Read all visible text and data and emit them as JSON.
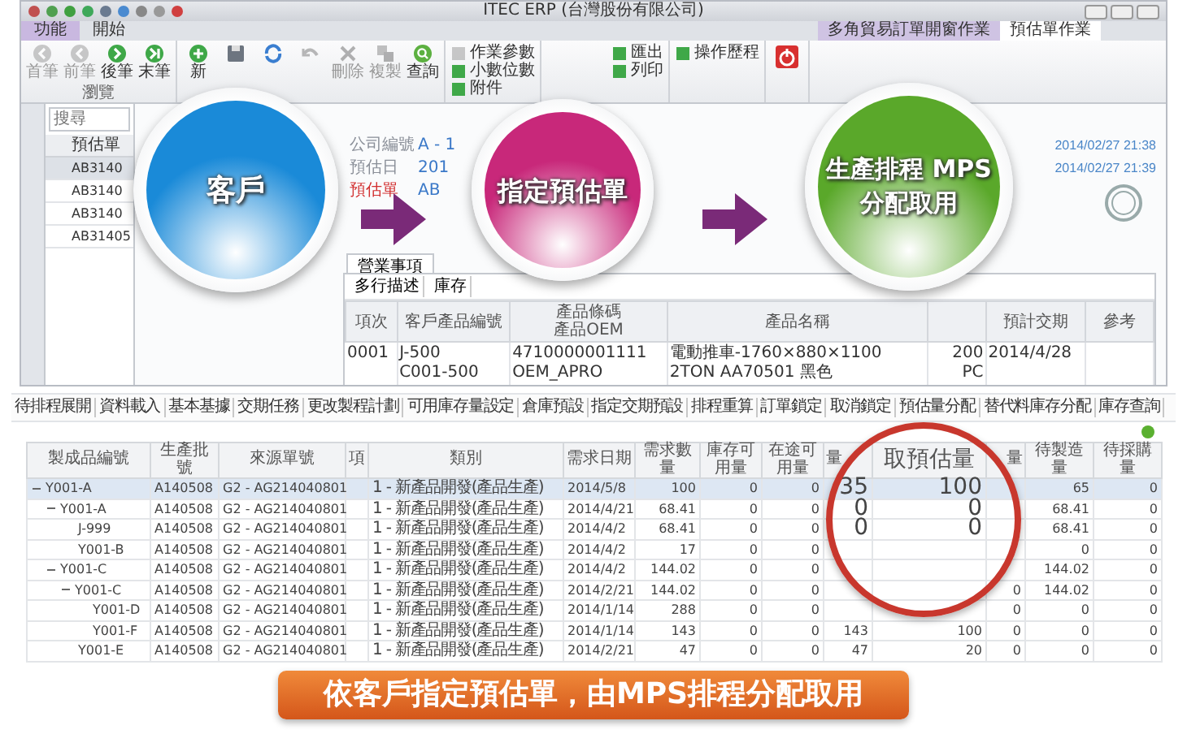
{
  "window": {
    "title": "ITEC ERP (台灣股份有限公司)",
    "menu_tabs": [
      {
        "label": "功能",
        "selected": true
      },
      {
        "label": "開始",
        "selected": false
      }
    ],
    "doc_tabs": [
      {
        "label": "多角貿易訂單開窗作業",
        "selected": false
      },
      {
        "label": "預估單作業",
        "selected": true
      }
    ]
  },
  "ribbon": {
    "groups": [
      {
        "label": "瀏覽",
        "buttons": [
          {
            "label": "首筆",
            "kind": "first",
            "disabled": true
          },
          {
            "label": "前筆",
            "kind": "prev",
            "disabled": true
          },
          {
            "label": "後筆",
            "kind": "next",
            "disabled": false
          },
          {
            "label": "末筆",
            "kind": "last",
            "disabled": false
          }
        ]
      },
      {
        "buttons": [
          {
            "label": "新",
            "kind": "add",
            "disabled": false
          },
          {
            "kind": "save",
            "disabled": false
          },
          {
            "kind": "refresh",
            "disabled": false
          },
          {
            "kind": "undo",
            "disabled": true
          },
          {
            "label": "刪除",
            "kind": "delete",
            "disabled": true
          },
          {
            "label": "複製",
            "kind": "copy",
            "disabled": true
          },
          {
            "label": "查詢",
            "kind": "query",
            "disabled": false
          }
        ]
      },
      {
        "buttons": [
          {
            "label": "作業參數",
            "kind": "small",
            "disabled": true
          },
          {
            "label": "小數位數",
            "kind": "small",
            "disabled": false
          },
          {
            "label": "附件",
            "kind": "small",
            "disabled": false
          }
        ]
      },
      {
        "buttons": [
          {
            "label": "匯出",
            "kind": "small",
            "disabled": false
          },
          {
            "label": "列印",
            "kind": "small",
            "disabled": false
          }
        ]
      },
      {
        "buttons": [
          {
            "label": "操作歷程",
            "kind": "small",
            "disabled": false
          }
        ]
      },
      {
        "buttons": [
          {
            "kind": "power",
            "disabled": false
          }
        ]
      }
    ]
  },
  "list_panel": {
    "search": {
      "placeholder": "搜尋"
    },
    "header": "預估單",
    "rows": [
      {
        "text": "AB3140",
        "selected": true
      },
      {
        "text": "AB3140",
        "selected": false
      },
      {
        "text": "AB3140",
        "selected": false
      },
      {
        "text": "AB31405",
        "selected": false
      }
    ]
  },
  "form": {
    "fields": [
      {
        "label": "公司編號",
        "value": "A - 1",
        "required": false
      },
      {
        "label": "預估日",
        "value": "201",
        "required": false
      },
      {
        "label": "預估單",
        "value": "AB",
        "required": true
      }
    ],
    "timestamps": [
      "2014/02/27 21:38",
      "2014/02/27 21:39"
    ],
    "tabs": [
      {
        "label": "營業事項",
        "selected": true
      }
    ],
    "subtools": [
      "多行描述",
      "庫存"
    ],
    "columns": [
      {
        "lines": [
          "項次"
        ]
      },
      {
        "lines": [
          "客戶產品編號"
        ]
      },
      {
        "lines": [
          "產品條碼",
          "產品OEM"
        ]
      },
      {
        "lines": [
          "產品名稱"
        ]
      },
      {},
      {
        "lines": [
          "預計交期"
        ]
      },
      {
        "lines": [
          "參考"
        ]
      }
    ],
    "rows": [
      {
        "cells": [
          [
            "0001"
          ],
          [
            "J-500",
            "C001-500"
          ],
          [
            "4710000001111",
            "OEM_APRO"
          ],
          [
            "電動推車-1760×880×1100",
            "2TON AA70501 黑色"
          ],
          [
            "200",
            "PC"
          ],
          [
            "2014/4/28"
          ]
        ]
      }
    ]
  },
  "steps": [
    {
      "lines": [
        "客戶"
      ],
      "color": "#1a8ad8"
    },
    {
      "lines": [
        "指定預估單"
      ],
      "color": "#c8287a"
    },
    {
      "lines": [
        "生產排程 MPS",
        "分配取用"
      ],
      "color": "#5aa82a"
    }
  ],
  "functions": [
    "待排程展開",
    "資料載入",
    "基本基據",
    "交期任務",
    "更改製程計劃",
    "可用庫存量設定",
    "倉庫預設",
    "指定交期預設",
    "排程重算",
    "訂單鎖定",
    "取消鎖定",
    "預估量分配",
    "替代料庫存分配",
    "庫存查詢"
  ],
  "table": {
    "columns": [
      {
        "label": "製成品編號"
      },
      {
        "label": "生產批號"
      },
      {
        "label": "來源單號"
      },
      {
        "label": "項"
      },
      {
        "label": "類別"
      },
      {
        "label": "需求日期"
      },
      {
        "label": "需求數量"
      },
      {
        "label": "庫存可用量"
      },
      {
        "label": "在途可用量"
      },
      {
        "label": "量"
      },
      {
        "label": "取預估量"
      },
      {
        "label": "量"
      },
      {
        "label": "待製造量"
      },
      {
        "label": "待採購量"
      }
    ],
    "rows": [
      {
        "item": "Y001-A",
        "lot": "A140508",
        "source": "G2 - AG214040801",
        "category": "1 - 新產品開發(產品生產)",
        "date": "2014/5/8",
        "qty": {
          "demand": "100",
          "stock": "0",
          "in_transit": "0",
          "column_10": "35",
          "estimate_taken": "100",
          "to_make": "65",
          "to_purchase": "0"
        },
        "selected": true,
        "expanded": true,
        "children": [
          {
            "item": "Y001-A",
            "lot": "A140508",
            "source": "G2 - AG214040801",
            "category": "1 - 新產品開發(產品生產)",
            "date": "2014/4/21",
            "qty": {
              "demand": "68.41",
              "stock": "0",
              "in_transit": "0",
              "column_10": "0",
              "estimate_taken": "0",
              "to_make": "68.41",
              "to_purchase": "0"
            },
            "selected": false,
            "expanded": true,
            "children": [
              {
                "item": "J-999",
                "lot": "A140508",
                "source": "G2 - AG214040801",
                "category": "1 - 新產品開發(產品生產)",
                "date": "2014/4/2",
                "qty": {
                  "demand": "68.41",
                  "stock": "0",
                  "in_transit": "0",
                  "column_10": "0",
                  "estimate_taken": "0",
                  "to_make": "68.41",
                  "to_purchase": "0"
                },
                "selected": false
              },
              {
                "item": "Y001-B",
                "lot": "A140508",
                "source": "G2 - AG214040801",
                "category": "1 - 新產品開發(產品生產)",
                "date": "2014/4/2",
                "qty": {
                  "demand": "17",
                  "stock": "0",
                  "in_transit": "0",
                  "to_make": "0",
                  "to_purchase": "0"
                },
                "selected": false
              }
            ]
          },
          {
            "item": "Y001-C",
            "lot": "A140508",
            "source": "G2 - AG214040801",
            "category": "1 - 新產品開發(產品生產)",
            "date": "2014/4/2",
            "qty": {
              "demand": "144.02",
              "stock": "0",
              "in_transit": "0",
              "to_make": "144.02",
              "to_purchase": "0"
            },
            "selected": false,
            "expanded": true,
            "children": [
              {
                "item": "Y001-C",
                "lot": "A140508",
                "source": "G2 - AG214040801",
                "category": "1 - 新產品開發(產品生產)",
                "date": "2014/2/21",
                "qty": {
                  "demand": "144.02",
                  "stock": "0",
                  "in_transit": "0",
                  "column_12": "0",
                  "to_make": "144.02",
                  "to_purchase": "0"
                },
                "selected": false,
                "expanded": true,
                "children": [
                  {
                    "item": "Y001-D",
                    "lot": "A140508",
                    "source": "G2 - AG214040801",
                    "category": "1 - 新產品開發(產品生產)",
                    "date": "2014/1/14",
                    "qty": {
                      "demand": "288",
                      "stock": "0",
                      "in_transit": "0",
                      "column_12": "0",
                      "to_make": "0",
                      "to_purchase": "0"
                    },
                    "selected": false
                  },
                  {
                    "item": "Y001-F",
                    "lot": "A140508",
                    "source": "G2 - AG214040801",
                    "category": "1 - 新產品開發(產品生產)",
                    "date": "2014/1/14",
                    "qty": {
                      "demand": "143",
                      "stock": "0",
                      "in_transit": "0",
                      "column_10": "143",
                      "estimate_taken": "100",
                      "column_12": "0",
                      "to_make": "0",
                      "to_purchase": "0"
                    },
                    "selected": false
                  }
                ]
              },
              {
                "item": "Y001-E",
                "lot": "A140508",
                "source": "G2 - AG214040801",
                "category": "1 - 新產品開發(產品生產)",
                "date": "2014/2/21",
                "qty": {
                  "demand": "47",
                  "stock": "0",
                  "in_transit": "0",
                  "column_10": "47",
                  "estimate_taken": "20",
                  "column_12": "0",
                  "to_make": "0",
                  "to_purchase": "0"
                },
                "selected": false
              }
            ]
          }
        ]
      }
    ]
  },
  "banner": "依客戶指定預估單，由MPS排程分配取用"
}
